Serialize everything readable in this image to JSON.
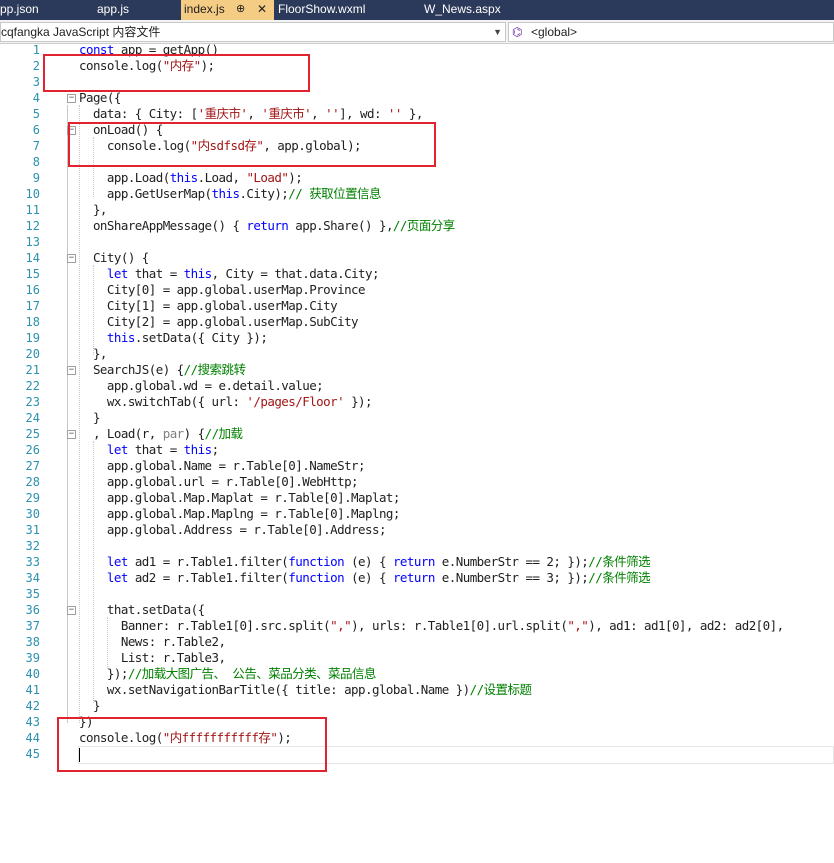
{
  "tabs": [
    {
      "label": "pp.json",
      "active": false
    },
    {
      "label": "app.js",
      "active": false
    },
    {
      "label": "index.js",
      "active": true,
      "pin": "⊕",
      "close": "✕"
    },
    {
      "label": "FloorShow.wxml",
      "active": false
    },
    {
      "label": "W_News.aspx",
      "active": false
    }
  ],
  "navbar": {
    "project": "cqfangka JavaScript 内容文件",
    "scope": "<global>"
  },
  "lines": [
    {
      "n": "1",
      "code": "const app = getApp()"
    },
    {
      "n": "2",
      "code": "console.log(\"内存\");"
    },
    {
      "n": "3",
      "code": ""
    },
    {
      "n": "4",
      "code": "Page({"
    },
    {
      "n": "5",
      "code": "  data: { City: ['重庆市', '重庆市', ''], wd: '' },"
    },
    {
      "n": "6",
      "code": "  onLoad() {"
    },
    {
      "n": "7",
      "code": "    console.log(\"内sdfsd存\", app.global);"
    },
    {
      "n": "8",
      "code": ""
    },
    {
      "n": "9",
      "code": "    app.Load(this.Load, \"Load\");"
    },
    {
      "n": "10",
      "code": "    app.GetUserMap(this.City);// 获取位置信息"
    },
    {
      "n": "11",
      "code": "  },"
    },
    {
      "n": "12",
      "code": "  onShareAppMessage() { return app.Share() },//页面分享"
    },
    {
      "n": "13",
      "code": ""
    },
    {
      "n": "14",
      "code": "  City() {"
    },
    {
      "n": "15",
      "code": "    let that = this, City = that.data.City;"
    },
    {
      "n": "16",
      "code": "    City[0] = app.global.userMap.Province"
    },
    {
      "n": "17",
      "code": "    City[1] = app.global.userMap.City"
    },
    {
      "n": "18",
      "code": "    City[2] = app.global.userMap.SubCity"
    },
    {
      "n": "19",
      "code": "    this.setData({ City });"
    },
    {
      "n": "20",
      "code": "  },"
    },
    {
      "n": "21",
      "code": "  SearchJS(e) {//搜索跳转"
    },
    {
      "n": "22",
      "code": "    app.global.wd = e.detail.value;"
    },
    {
      "n": "23",
      "code": "    wx.switchTab({ url: '/pages/Floor' });"
    },
    {
      "n": "24",
      "code": "  }"
    },
    {
      "n": "25",
      "code": "  , Load(r, par) {//加载"
    },
    {
      "n": "26",
      "code": "    let that = this;"
    },
    {
      "n": "27",
      "code": "    app.global.Name = r.Table[0].NameStr;"
    },
    {
      "n": "28",
      "code": "    app.global.url = r.Table[0].WebHttp;"
    },
    {
      "n": "29",
      "code": "    app.global.Map.Maplat = r.Table[0].Maplat;"
    },
    {
      "n": "30",
      "code": "    app.global.Map.Maplng = r.Table[0].Maplng;"
    },
    {
      "n": "31",
      "code": "    app.global.Address = r.Table[0].Address;"
    },
    {
      "n": "32",
      "code": ""
    },
    {
      "n": "33",
      "code": "    let ad1 = r.Table1.filter(function (e) { return e.NumberStr == 2; });//条件筛选"
    },
    {
      "n": "34",
      "code": "    let ad2 = r.Table1.filter(function (e) { return e.NumberStr == 3; });//条件筛选"
    },
    {
      "n": "35",
      "code": ""
    },
    {
      "n": "36",
      "code": "    that.setData({"
    },
    {
      "n": "37",
      "code": "      Banner: r.Table1[0].src.split(\",\"), urls: r.Table1[0].url.split(\",\"), ad1: ad1[0], ad2: ad2[0],"
    },
    {
      "n": "38",
      "code": "      News: r.Table2,"
    },
    {
      "n": "39",
      "code": "      List: r.Table3,"
    },
    {
      "n": "40",
      "code": "    });//加载大图广告、 公告、菜品分类、菜品信息"
    },
    {
      "n": "41",
      "code": "    wx.setNavigationBarTitle({ title: app.global.Name })//设置标题"
    },
    {
      "n": "42",
      "code": "  }"
    },
    {
      "n": "43",
      "code": "})"
    },
    {
      "n": "44",
      "code": "console.log(\"内fffffffffff存\");"
    },
    {
      "n": "45",
      "code": ""
    }
  ],
  "highlight_color": "#e0232f"
}
